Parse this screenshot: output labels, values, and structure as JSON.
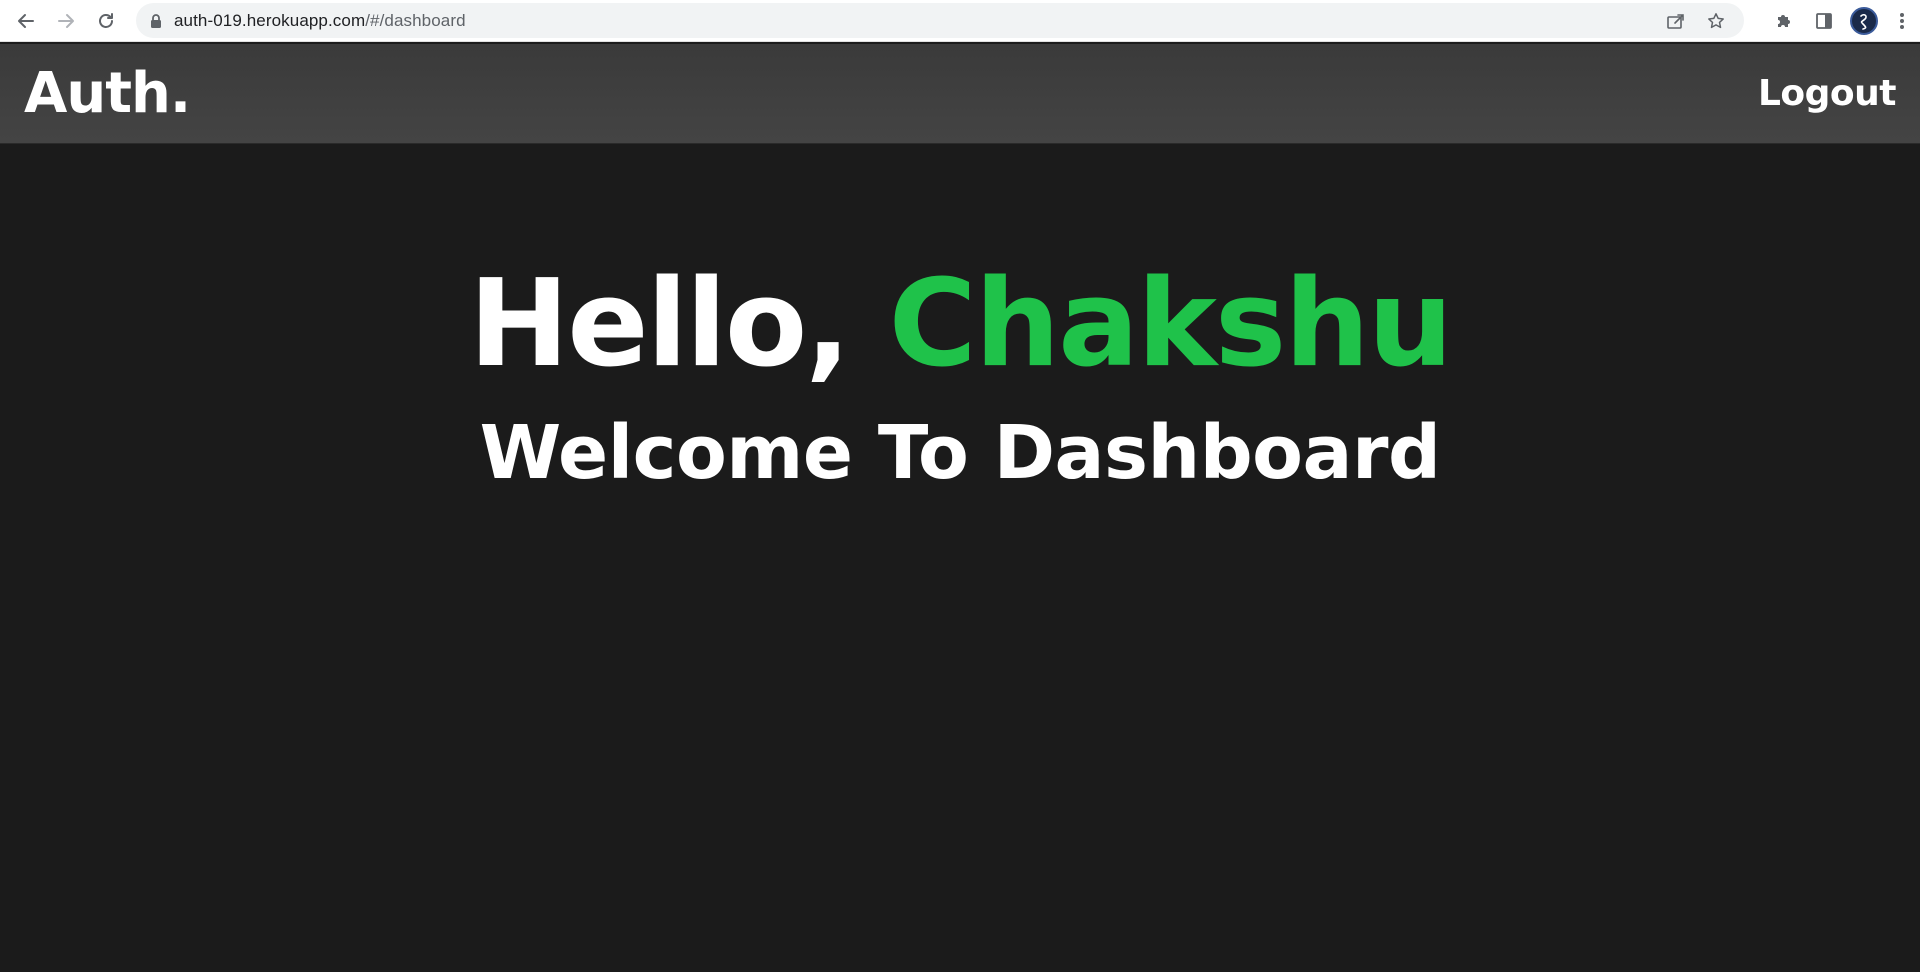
{
  "browser": {
    "url_host": "auth-019.herokuapp.com",
    "url_path": "/#/dashboard",
    "icons": {
      "back": "back-arrow-icon",
      "forward": "forward-arrow-icon",
      "reload": "reload-icon",
      "lock": "lock-icon",
      "share": "share-icon",
      "bookmark": "star-icon",
      "extensions": "puzzle-icon",
      "side_panel": "side-panel-icon",
      "profile": "avatar",
      "menu": "kebab-menu-icon"
    }
  },
  "header": {
    "brand": "Auth.",
    "logout_label": "Logout"
  },
  "main": {
    "greeting": "Hello,",
    "user_name": "Chakshu",
    "welcome": "Welcome To Dashboard"
  },
  "colors": {
    "accent": "#1fc24a",
    "background": "#1b1b1b",
    "header_bg": "#404040",
    "text": "#ffffff"
  }
}
